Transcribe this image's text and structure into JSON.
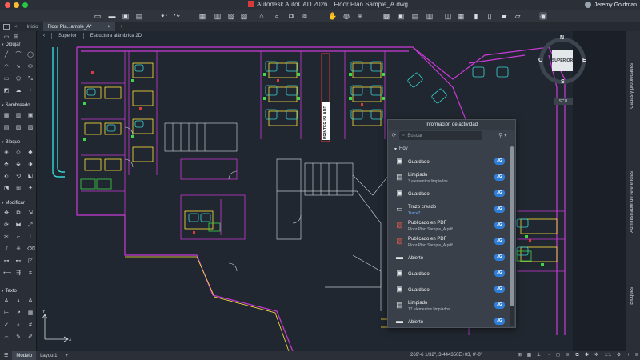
{
  "window": {
    "app_title": "Autodesk AutoCAD 2026",
    "file_title": "Floor Plan Sample_A.dwg",
    "user_name": "Jeremy Goldman",
    "traffic_colors": [
      "#ff5f57",
      "#febc2e",
      "#28c840"
    ]
  },
  "tabs": [
    {
      "label": "Inicio",
      "active": false
    },
    {
      "label": "Floor Pla...ample_A*",
      "active": true
    }
  ],
  "viewport": {
    "view_label": "Superior",
    "style_label": "Estructura alámbrica 2D"
  },
  "left_palette": {
    "sections": [
      "Dibujar",
      "Sombreado",
      "Bloque",
      "Modificar",
      "Texto"
    ]
  },
  "viewcube": {
    "face_label": "SUPERIOR",
    "north": "N",
    "south": "S",
    "east": "E",
    "west": "O",
    "ucs_label": "SCU"
  },
  "right_rail": {
    "labels": [
      "Capas y propiedades",
      "Administrador de referencias",
      "Bloques"
    ]
  },
  "status_bar": {
    "tabs": [
      {
        "label": "Modelo",
        "active": true
      },
      {
        "label": "Layout1",
        "active": false
      }
    ],
    "coordinates": "269'-6 1/32\", 3.444350E+03, 0'-0\"",
    "scale": "1:1"
  },
  "activity_panel": {
    "title": "Información de actividad",
    "search_placeholder": "Buscar",
    "group_label": "Hoy",
    "items": [
      {
        "icon": "save-icon",
        "label": "Guardado",
        "sub": "",
        "badge": "JG"
      },
      {
        "icon": "purge-icon",
        "label": "Limpiado",
        "sub": "3 elementos limpiados",
        "badge": "JG"
      },
      {
        "icon": "save-icon",
        "label": "Guardado",
        "sub": "",
        "badge": "JG"
      },
      {
        "icon": "trace-icon",
        "label": "Trazo creado",
        "sub": "Trace7",
        "sub_link": true,
        "badge": "JG"
      },
      {
        "icon": "pdf-icon",
        "label": "Publicado en PDF",
        "sub": "Floor Plan Sample_A.pdf",
        "badge": "JG"
      },
      {
        "icon": "pdf-icon",
        "label": "Publicado en PDF",
        "sub": "Floor Plan Sample_A.pdf",
        "badge": "JG"
      },
      {
        "icon": "folder-icon",
        "label": "Abierto",
        "sub": "",
        "badge": "JG"
      },
      {
        "icon": "save-icon",
        "label": "Guardado",
        "sub": "",
        "badge": "JG"
      },
      {
        "icon": "save-icon",
        "label": "Guardado",
        "sub": "",
        "badge": "JG"
      },
      {
        "icon": "purge-icon",
        "label": "Limpiado",
        "sub": "17 elementos limpiados",
        "badge": "JG"
      },
      {
        "icon": "folder-icon",
        "label": "Abierto",
        "sub": "",
        "badge": "JG"
      }
    ]
  },
  "drawing": {
    "room_label": "PRINTER ISLAND",
    "colors": {
      "wall": "#c93bd6",
      "furniture": "#38d6d6",
      "text": "#ffe23a",
      "green": "#3fd64a",
      "white": "#d8dde2",
      "red": "#e03a3a"
    }
  }
}
